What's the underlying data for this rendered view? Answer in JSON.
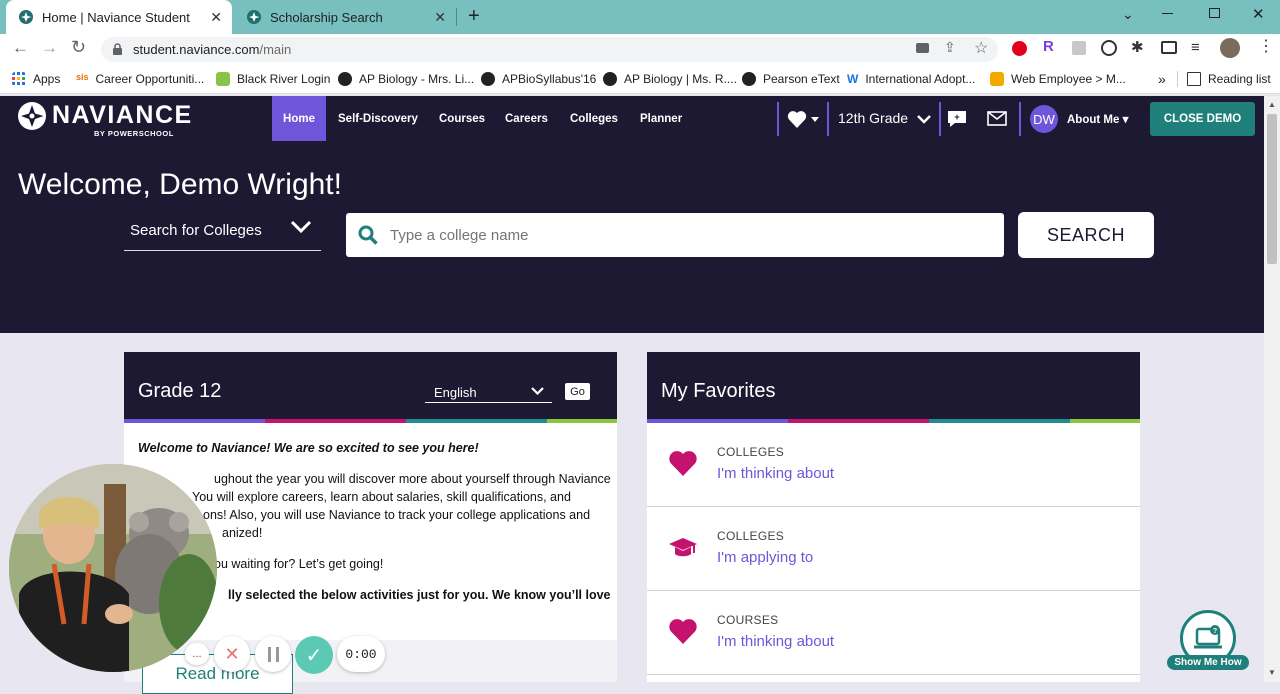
{
  "browser": {
    "tabs": [
      {
        "title": "Home | Naviance Student",
        "active": true
      },
      {
        "title": "Scholarship Search",
        "active": false
      }
    ],
    "url_host": "student.naviance.com",
    "url_path": "/main",
    "bookmarks": [
      {
        "label": "Apps"
      },
      {
        "label": "Career Opportuniti..."
      },
      {
        "label": "Black River Login"
      },
      {
        "label": "AP Biology - Mrs. Li..."
      },
      {
        "label": "APBioSyllabus'16"
      },
      {
        "label": "AP Biology | Ms. R...."
      },
      {
        "label": "Pearson eText"
      },
      {
        "label": "International Adopt..."
      },
      {
        "label": "Web Employee > M..."
      }
    ],
    "overflow_label": "»",
    "reading_list": "Reading list"
  },
  "naviance": {
    "brand": "NAVIANCE",
    "brand_sub": "BY POWERSCHOOL",
    "nav": [
      "Home",
      "Self-Discovery",
      "Courses",
      "Careers",
      "Colleges",
      "Planner"
    ],
    "grade_select": "12th Grade",
    "avatar_initials": "DW",
    "about_me": "About Me",
    "close_demo": "CLOSE DEMO",
    "welcome": "Welcome, Demo Wright!",
    "search": {
      "mode": "Search for Colleges",
      "placeholder": "Type a college name",
      "button": "SEARCH"
    }
  },
  "grade_card": {
    "title": "Grade 12",
    "language": "English",
    "go": "Go",
    "intro": "Welcome to Naviance! We are so excited to see you here!",
    "p1_l1": "ughout the year you will discover more about yourself through Naviance",
    "p1_l2": "You will explore careers, learn about salaries, skill qualifications, and",
    "p1_l3": "ons! Also, you will use Naviance to track your college applications and",
    "p1_l4": "anized!",
    "p2": "ou waiting for? Let’s get going!",
    "p3": "lly selected the below activities just for you. We know you’ll love",
    "read_more": "Read more"
  },
  "favorites": {
    "title": "My Favorites",
    "items": [
      {
        "category": "COLLEGES",
        "label": "I'm thinking about",
        "icon": "heart-icon"
      },
      {
        "category": "COLLEGES",
        "label": "I'm applying to",
        "icon": "graduation-cap-icon"
      },
      {
        "category": "COURSES",
        "label": "I'm thinking about",
        "icon": "heart-icon"
      }
    ]
  },
  "recorder": {
    "more": "...",
    "timer": "0:00"
  },
  "show_me_how": "Show Me How",
  "colors": {
    "header_bg": "#1e1933",
    "accent_purple": "#6e56db",
    "teal": "#1f7f7a",
    "magenta": "#c4136f",
    "tabstrip": "#78bfbf",
    "stripe": [
      "#6e56db",
      "#c4136f",
      "#1f8e8c",
      "#8cc63f"
    ]
  }
}
